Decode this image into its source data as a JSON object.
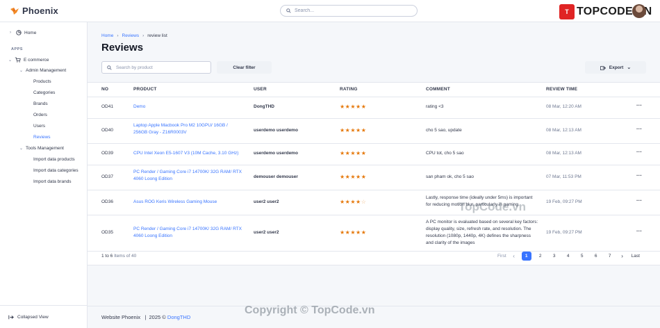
{
  "app": {
    "name": "Phoenix"
  },
  "topbar": {
    "search_placeholder": "Search...",
    "brand_badge": "T",
    "brand_text": "TOPCODE.VN"
  },
  "sidebar": {
    "home": "Home",
    "section_apps": "APPS",
    "ecommerce": "E commerce",
    "admin_management": "Admin Management",
    "admin_items": [
      "Products",
      "Categories",
      "Brands",
      "Orders",
      "Users",
      "Reviews"
    ],
    "tools_management": "Tools Management",
    "tools_items": [
      "Import data products",
      "Import data categories",
      "Import data brands"
    ],
    "collapsed_view": "Collapsed View"
  },
  "breadcrumb": {
    "home": "Home",
    "reviews": "Reviews",
    "current": "review list"
  },
  "page": {
    "title": "Reviews",
    "search_placeholder": "Search by product",
    "clear_filter": "Clear filter",
    "export": "Export"
  },
  "table": {
    "headers": {
      "no": "NO",
      "product": "PRODUCT",
      "user": "USER",
      "rating": "RATING",
      "comment": "COMMENT",
      "time": "REVIEW TIME"
    },
    "rows": [
      {
        "no": "OD41",
        "product": [
          "Demo"
        ],
        "user": "DongTHD",
        "rating": 5,
        "comment": [
          "rating <3"
        ],
        "time": "08 Mar, 12:20 AM"
      },
      {
        "no": "OD40",
        "product": [
          "Laptop Apple Macbook Pro M2 10GPU/ 16GB /",
          "256GB Gray - Z16R0003V"
        ],
        "user": "userdemo userdemo",
        "rating": 5,
        "comment": [
          "cho 5 sao, update"
        ],
        "time": "08 Mar, 12:13 AM"
      },
      {
        "no": "OD39",
        "product": [
          "CPU Intel Xeon E5-1607 V3 (10M Cache, 3.10 GHz)"
        ],
        "user": "userdemo userdemo",
        "rating": 5,
        "comment": [
          "CPU tot, cho 5 sao"
        ],
        "time": "08 Mar, 12:13 AM"
      },
      {
        "no": "OD37",
        "product": [
          "PC Render / Gaming Core i7 14700K/ 32G RAM/ RTX",
          "4060 Loong Edition"
        ],
        "user": "demouser demouser",
        "rating": 5,
        "comment": [
          "san pham ok, cho 5 sao"
        ],
        "time": "07 Mar, 11:53 PM"
      },
      {
        "no": "OD36",
        "product": [
          "Asus ROG Keris Wireless Gaming Mouse"
        ],
        "user": "user2 user2",
        "rating": 4,
        "comment": [
          "Lastly, response time (ideally under 5ms) is important",
          "for reducing motion blur, particularly in gaming."
        ],
        "time": "19 Feb, 09:27 PM"
      },
      {
        "no": "OD35",
        "product": [
          "PC Render / Gaming Core i7 14700K/ 32G RAM/ RTX",
          "4060 Loong Edition"
        ],
        "user": "user2 user2",
        "rating": 5,
        "comment": [
          "A PC monitor is evaluated based on several key factors:",
          "display quality, size, refresh rate, and resolution. The",
          "resolution (1080p, 1440p, 4K) defines the sharpness",
          "and clarity of the images"
        ],
        "time": "19 Feb, 09:27 PM"
      }
    ],
    "more_glyph": "···"
  },
  "pagination": {
    "range": "1 to 6",
    "items_label": "Items of 40",
    "first": "First",
    "pages": [
      "1",
      "2",
      "3",
      "4",
      "5",
      "6",
      "7"
    ],
    "active": "1",
    "last": "Last"
  },
  "footer": {
    "text": "Website Phoenix   |  2025 ©",
    "author": "DongTHD"
  },
  "watermarks": {
    "middle": "TopCode.vn",
    "bottom": "Copyright © TopCode.vn"
  }
}
